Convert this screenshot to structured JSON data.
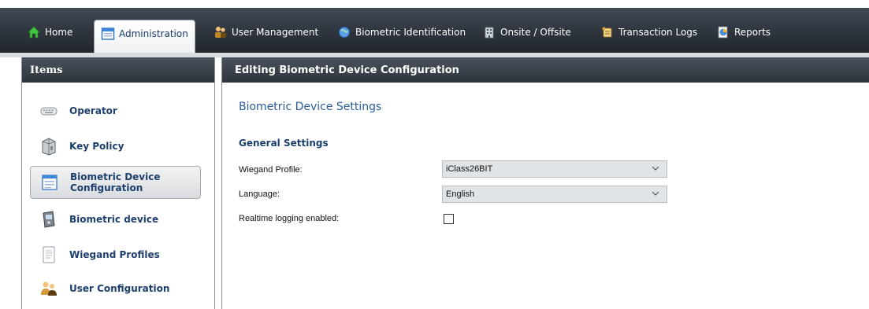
{
  "navbar": {
    "tabs": [
      {
        "label": "Home",
        "icon": "home-icon",
        "active": false
      },
      {
        "label": "Administration",
        "icon": "window-icon",
        "active": true
      },
      {
        "label": "User Management",
        "icon": "users-icon",
        "active": false
      },
      {
        "label": "Biometric Identification",
        "icon": "globe-icon",
        "active": false
      },
      {
        "label": "Onsite / Offsite",
        "icon": "building-icon",
        "active": false
      },
      {
        "label": "Transaction Logs",
        "icon": "scroll-icon",
        "active": false
      },
      {
        "label": "Reports",
        "icon": "reports-icon",
        "active": false
      }
    ]
  },
  "sidebar": {
    "title": "Items",
    "items": [
      {
        "label": "Operator",
        "icon": "keyboard-icon",
        "selected": false
      },
      {
        "label": "Key Policy",
        "icon": "key-policy-icon",
        "selected": false
      },
      {
        "label": "Biometric Device Configuration",
        "icon": "device-config-icon",
        "selected": true
      },
      {
        "label": "Biometric device",
        "icon": "biometric-device-icon",
        "selected": false
      },
      {
        "label": "Wiegand Profiles",
        "icon": "document-icon",
        "selected": false
      },
      {
        "label": "User Configuration",
        "icon": "users-config-icon",
        "selected": false
      }
    ]
  },
  "main": {
    "header": "Editing Biometric Device Configuration",
    "section_title": "Biometric Device Settings",
    "group_title": "General Settings",
    "fields": {
      "wiegand_profile": {
        "label": "Wiegand Profile:",
        "value": "iClass26BIT"
      },
      "language": {
        "label": "Language:",
        "value": "English"
      },
      "realtime_logging": {
        "label": "Realtime logging enabled:",
        "checked": false
      }
    }
  },
  "colors": {
    "nav_bg": "#2f353d",
    "header_bg": "#3a4048",
    "accent_text": "#1d3f6e",
    "section_title": "#2a5d9a",
    "select_bg": "#e1e4e7"
  }
}
